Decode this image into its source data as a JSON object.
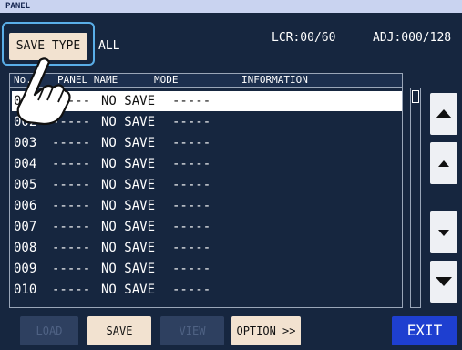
{
  "window": {
    "title": "PANEL"
  },
  "toolbar": {
    "save_type_label": "SAVE TYPE",
    "filter_value": "ALL",
    "lcr_status": "LCR:00/60",
    "adj_status": "ADJ:000/128"
  },
  "table": {
    "columns": [
      "No.",
      "PANEL NAME",
      "MODE",
      "INFORMATION"
    ],
    "rows": [
      {
        "no": "001",
        "name": "-----",
        "mode": "NO SAVE",
        "info": "-----"
      },
      {
        "no": "002",
        "name": "-----",
        "mode": "NO SAVE",
        "info": "-----"
      },
      {
        "no": "003",
        "name": "-----",
        "mode": "NO SAVE",
        "info": "-----"
      },
      {
        "no": "004",
        "name": "-----",
        "mode": "NO SAVE",
        "info": "-----"
      },
      {
        "no": "005",
        "name": "-----",
        "mode": "NO SAVE",
        "info": "-----"
      },
      {
        "no": "006",
        "name": "-----",
        "mode": "NO SAVE",
        "info": "-----"
      },
      {
        "no": "007",
        "name": "-----",
        "mode": "NO SAVE",
        "info": "-----"
      },
      {
        "no": "008",
        "name": "-----",
        "mode": "NO SAVE",
        "info": "-----"
      },
      {
        "no": "009",
        "name": "-----",
        "mode": "NO SAVE",
        "info": "-----"
      },
      {
        "no": "010",
        "name": "-----",
        "mode": "NO SAVE",
        "info": "-----"
      }
    ],
    "selected_row": 1
  },
  "nav_buttons": [
    {
      "icon": "page-up-icon"
    },
    {
      "icon": "line-up-icon"
    },
    {
      "icon": "line-down-icon"
    },
    {
      "icon": "page-down-icon"
    }
  ],
  "bottom_buttons": {
    "load": "LOAD",
    "save": "SAVE",
    "view": "VIEW",
    "option": "OPTION >>",
    "exit": "EXIT"
  },
  "colors": {
    "background": "#16263f",
    "title_bar": "#c9d3f0",
    "active_button": "#f2e2d0",
    "exit_button": "#1e3fd0",
    "highlight": "#5aaee8"
  }
}
